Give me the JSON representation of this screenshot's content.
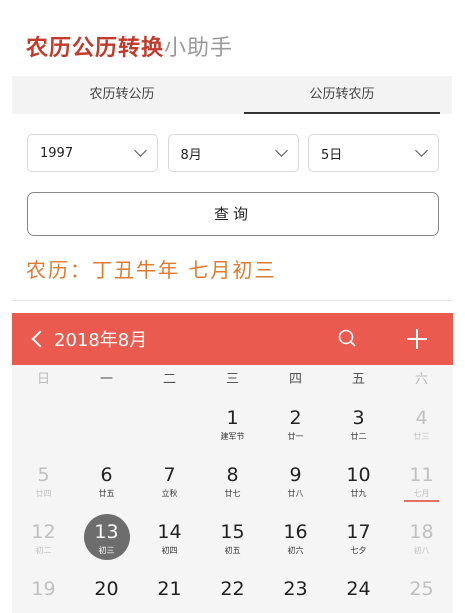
{
  "title": {
    "red": "农历公历转换",
    "grey": "小助手"
  },
  "tabs": [
    {
      "label": "农历转公历",
      "active": false
    },
    {
      "label": "公历转农历",
      "active": true
    }
  ],
  "selects": {
    "year": "1997",
    "month": "8月",
    "day": "5日"
  },
  "query_button": "查询",
  "result": "农历：丁丑牛年 七月初三",
  "calendar": {
    "month_label": "2018年8月",
    "weekdays": [
      "日",
      "一",
      "二",
      "三",
      "四",
      "五",
      "六"
    ],
    "rows": [
      [
        {
          "day": "",
          "lunar": ""
        },
        {
          "day": "",
          "lunar": ""
        },
        {
          "day": "",
          "lunar": ""
        },
        {
          "day": "1",
          "lunar": "建军节"
        },
        {
          "day": "2",
          "lunar": "廿一"
        },
        {
          "day": "3",
          "lunar": "廿二"
        },
        {
          "day": "4",
          "lunar": "廿三",
          "dim": true
        }
      ],
      [
        {
          "day": "5",
          "lunar": "廿四",
          "dim": true
        },
        {
          "day": "6",
          "lunar": "廿五"
        },
        {
          "day": "7",
          "lunar": "立秋"
        },
        {
          "day": "8",
          "lunar": "廿七"
        },
        {
          "day": "9",
          "lunar": "廿八"
        },
        {
          "day": "10",
          "lunar": "廿九"
        },
        {
          "day": "11",
          "lunar": "七月",
          "dim": true,
          "mark": true
        }
      ],
      [
        {
          "day": "12",
          "lunar": "初二",
          "dim": true
        },
        {
          "day": "13",
          "lunar": "初三",
          "selected": true
        },
        {
          "day": "14",
          "lunar": "初四"
        },
        {
          "day": "15",
          "lunar": "初五"
        },
        {
          "day": "16",
          "lunar": "初六"
        },
        {
          "day": "17",
          "lunar": "七夕"
        },
        {
          "day": "18",
          "lunar": "初八",
          "dim": true
        }
      ],
      [
        {
          "day": "19",
          "lunar": "",
          "dim": true
        },
        {
          "day": "20",
          "lunar": ""
        },
        {
          "day": "21",
          "lunar": ""
        },
        {
          "day": "22",
          "lunar": ""
        },
        {
          "day": "23",
          "lunar": ""
        },
        {
          "day": "24",
          "lunar": ""
        },
        {
          "day": "25",
          "lunar": "",
          "dim": true
        }
      ]
    ]
  },
  "colors": {
    "title_red": "#c23a2c",
    "result_orange": "#e07a2e",
    "header_red": "#ea5a4e",
    "selected_grey": "#6d6d6d"
  },
  "icons": {
    "back": "chevron-left-icon",
    "search": "search-icon",
    "add": "plus-icon",
    "dropdown": "chevron-down-icon"
  }
}
